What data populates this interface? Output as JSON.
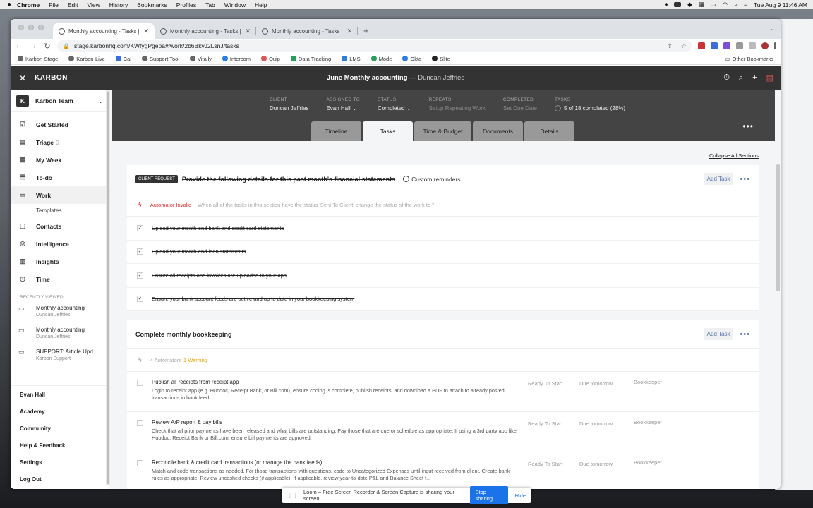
{
  "macmenu": {
    "apple": "",
    "app": "Chrome",
    "items": [
      "File",
      "Edit",
      "View",
      "History",
      "Bookmarks",
      "Profiles",
      "Tab",
      "Window",
      "Help"
    ],
    "clock": "Tue Aug 9  11:46 AM"
  },
  "browser": {
    "tabs": [
      {
        "title": "Monthly accounting - Tasks | K"
      },
      {
        "title": "Monthly accounting - Tasks | K"
      },
      {
        "title": "Monthly accounting - Tasks | K"
      }
    ],
    "url": "stage.karbonhq.com/KWfygPgepa#/work/2b6BkvJ2LsnJ/tasks",
    "bookmarks": [
      "Karbon-Stage",
      "Karbon-Live",
      "Cal",
      "Support Tool",
      "Vitally",
      "Intercom",
      "Quip",
      "Data Tracking",
      "LMS",
      "Mode",
      "Okta",
      "Slite"
    ],
    "other_bookmarks": "Other Bookmarks"
  },
  "app": {
    "logo": "KARBON",
    "title": "June Monthly accounting",
    "title_sep": " — ",
    "title_client": "Duncan Jeffries"
  },
  "sidebar": {
    "team_initial": "K",
    "team_name": "Karbon Team",
    "items": [
      {
        "label": "Get Started",
        "count": ""
      },
      {
        "label": "Triage",
        "count": "0"
      },
      {
        "label": "My Week",
        "count": ""
      },
      {
        "label": "To-do",
        "count": ""
      },
      {
        "label": "Work",
        "count": ""
      }
    ],
    "templates": "Templates",
    "items2": [
      "Contacts",
      "Intelligence",
      "Insights",
      "Time"
    ],
    "recent_header": "RECENTLY VIEWED",
    "recent": [
      {
        "title": "Monthly accounting",
        "sub": "Duncan Jeffries"
      },
      {
        "title": "Monthly accounting",
        "sub": "Duncan Jeffries"
      },
      {
        "title": "SUPPORT: Article Upd...",
        "sub": "Karbon Support"
      }
    ],
    "footer": [
      "Evan Hall",
      "Academy",
      "Community",
      "Help & Feedback",
      "Settings",
      "Log Out"
    ]
  },
  "header": {
    "meta": [
      {
        "label": "CLIENT",
        "value": "Duncan Jeffries"
      },
      {
        "label": "ASSIGNED TO",
        "value": "Evan Hall"
      },
      {
        "label": "STATUS",
        "value": "Completed"
      },
      {
        "label": "REPEATS",
        "value": "Setup Repeating Work"
      },
      {
        "label": "COMPLETED",
        "value": "Set Due Date"
      },
      {
        "label": "TASKS",
        "value": "5 of 18 completed (28%)"
      }
    ],
    "tabs": [
      "Timeline",
      "Tasks",
      "Time & Budget",
      "Documents",
      "Details"
    ],
    "active_tab": "Tasks"
  },
  "collapse_all": "Collapse All Sections",
  "section1": {
    "badge": "CLIENT REQUEST",
    "title": "Provide the following details for this past month's financial statements",
    "reminders": "Custom reminders",
    "add_task": "Add Task",
    "automator_status": "Automator Invalid",
    "automator_text": "When all of the tasks in this section have the status 'Sent To Client' change the status of the work to ''",
    "items": [
      "Upload your month-end bank and credit card statements",
      "Upload your month-end loan statements",
      "Ensure all receipts and invoices are uploaded to your app",
      "Ensure your bank account feeds are active and up to date in your bookkeeping system"
    ]
  },
  "section2": {
    "title": "Complete monthly bookkeeping",
    "add_task": "Add Task",
    "automators": "4 Automators",
    "warning": "1 Warning",
    "tasks": [
      {
        "title": "Publish all receipts from receipt app",
        "desc": "Login to receipt app (e.g. Hubdoc, Receipt Bank, or Bill.com), ensure coding is complete, publish receipts, and download a PDF to attach to already posted transactions in bank feed.",
        "status": "Ready To Start",
        "due": "Due tomorrow",
        "role": "Bookkeeper"
      },
      {
        "title": "Review A/P report & pay bills",
        "desc": "Check that all prior payments have been released and what bills are outstanding. Pay those that are due or schedule as appropriate. If using a 3rd party app like Hubdoc, Receipt Bank or Bill.com, ensure bill payments are approved.",
        "status": "Ready To Start",
        "due": "Due tomorrow",
        "role": "Bookkeeper"
      },
      {
        "title": "Reconcile bank & credit card transactions (or manage the bank feeds)",
        "desc": "Match and code transactions as needed. For those transactions with questions, code to Uncategorized Expenses until input received from client. Create bank rules as appropriate. Review uncashed checks (if applicable). If applicable, review year-to-date P&L and Balance Sheet f...",
        "status": "Ready To Start",
        "due": "Due tomorrow",
        "role": "Bookkeeper"
      }
    ]
  },
  "loom": {
    "text": "Loom – Free Screen Recorder & Screen Capture is sharing your screen.",
    "stop": "Stop sharing",
    "hide": "Hide"
  },
  "colors": {
    "topbar": "#333333",
    "header": "#444444",
    "accent": "#5674a8",
    "warning": "#e8a300",
    "error": "#dd3333"
  }
}
